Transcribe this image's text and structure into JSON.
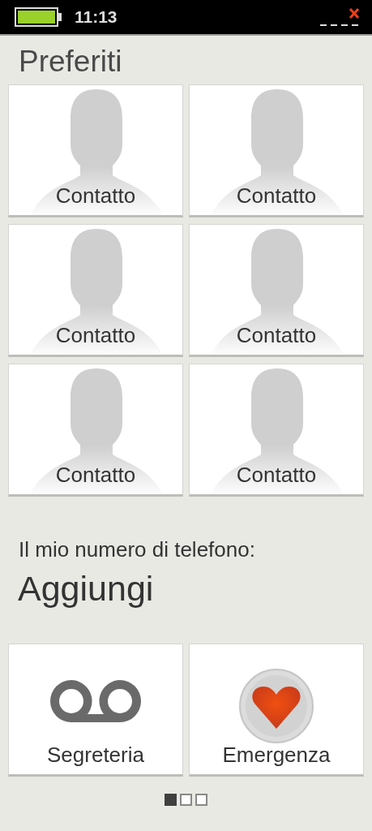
{
  "status_bar": {
    "time": "11:13"
  },
  "title": "Preferiti",
  "favorites": [
    {
      "label": "Contatto"
    },
    {
      "label": "Contatto"
    },
    {
      "label": "Contatto"
    },
    {
      "label": "Contatto"
    },
    {
      "label": "Contatto"
    },
    {
      "label": "Contatto"
    }
  ],
  "my_number": {
    "label": "Il mio numero di telefono:",
    "value": "Aggiungi"
  },
  "shortcuts": [
    {
      "kind": "voicemail",
      "label": "Segreteria"
    },
    {
      "kind": "emergency",
      "label": "Emergenza"
    }
  ],
  "pages": [
    {
      "selected": true
    },
    {
      "selected": false
    },
    {
      "selected": false
    }
  ]
}
